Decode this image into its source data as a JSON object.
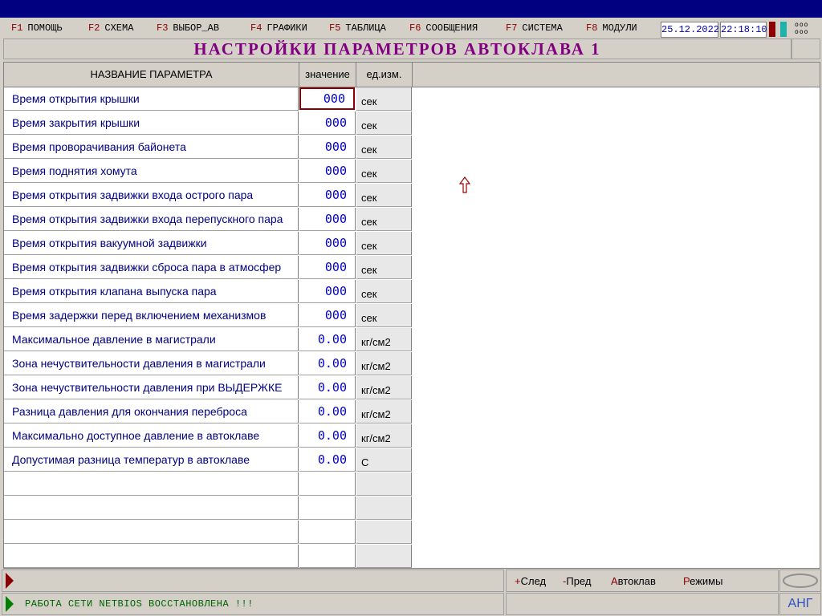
{
  "menu": [
    {
      "key": "F1",
      "label": "ПОМОЩЬ"
    },
    {
      "key": "F2",
      "label": "СХЕМА"
    },
    {
      "key": "F3",
      "label": "ВЫБОР_АВ"
    },
    {
      "key": "F4",
      "label": "ГРАФИКИ"
    },
    {
      "key": "F5",
      "label": "ТАБЛИЦА"
    },
    {
      "key": "F6",
      "label": "СООБЩЕНИЯ"
    },
    {
      "key": "F7",
      "label": "СИСТЕМА"
    },
    {
      "key": "F8",
      "label": "МОДУЛИ"
    }
  ],
  "date": "25.12.2022",
  "time": "22:18:10",
  "indicators": {
    "left_color": "#8b0000",
    "right_color": "#20b2aa"
  },
  "dots_icon": "ooo\nooo",
  "title": "НАСТРОЙКИ  ПАРАМЕТРОВ  АВТОКЛАВА  1",
  "columns": {
    "name": "НАЗВАНИЕ ПАРАМЕТРА",
    "value": "значение",
    "unit": "ед.изм."
  },
  "rows": [
    {
      "name": "Время открытия крышки",
      "value": "000",
      "unit": "сек"
    },
    {
      "name": "Время закрытия крышки",
      "value": "000",
      "unit": "сек"
    },
    {
      "name": "Время проворачивания байонета",
      "value": "000",
      "unit": "сек"
    },
    {
      "name": "Время поднятия хомута",
      "value": "000",
      "unit": "сек"
    },
    {
      "name": "Время открытия задвижки входа острого пара",
      "value": "000",
      "unit": "сек"
    },
    {
      "name": "Время открытия задвижки входа перепускного пара",
      "value": "000",
      "unit": "сек"
    },
    {
      "name": "Время открытия вакуумной задвижки",
      "value": "000",
      "unit": "сек"
    },
    {
      "name": "Время открытия задвижки сброса пара в атмосфер",
      "value": "000",
      "unit": "сек"
    },
    {
      "name": "Время открытия клапана выпуска пара",
      "value": "000",
      "unit": "сек"
    },
    {
      "name": "Время задержки перед включением механизмов",
      "value": "000",
      "unit": "сек"
    },
    {
      "name": "Максимальное давление в магистрали",
      "value": "0.00",
      "unit": "кг/см2"
    },
    {
      "name": "Зона нечуствительности давления в магистрали",
      "value": "0.00",
      "unit": "кг/см2"
    },
    {
      "name": "Зона нечуствительности давления при ВЫДЕРЖКЕ",
      "value": "0.00",
      "unit": "кг/см2"
    },
    {
      "name": "Разница давления для окончания переброса",
      "value": "0.00",
      "unit": "кг/см2"
    },
    {
      "name": "Максимально доступное давление в автоклаве",
      "value": "0.00",
      "unit": "кг/см2"
    },
    {
      "name": "Допустимая разница температур в автоклаве",
      "value": "0.00",
      "unit": "С"
    },
    {
      "name": "",
      "value": "",
      "unit": ""
    },
    {
      "name": "",
      "value": "",
      "unit": ""
    },
    {
      "name": "",
      "value": "",
      "unit": ""
    },
    {
      "name": "",
      "value": "",
      "unit": ""
    }
  ],
  "status_message": "РАБОТА СЕТИ NETBIOS ВОССТАНОВЛЕНА !!!",
  "nav": {
    "next": {
      "hot": "+",
      "rest": "След"
    },
    "prev": {
      "hot": "-",
      "rest": "Пред"
    },
    "autoclave": {
      "hot": "А",
      "rest": "втоклав"
    },
    "modes": {
      "hot": "Р",
      "rest": "ежимы"
    }
  },
  "language": "АНГ"
}
